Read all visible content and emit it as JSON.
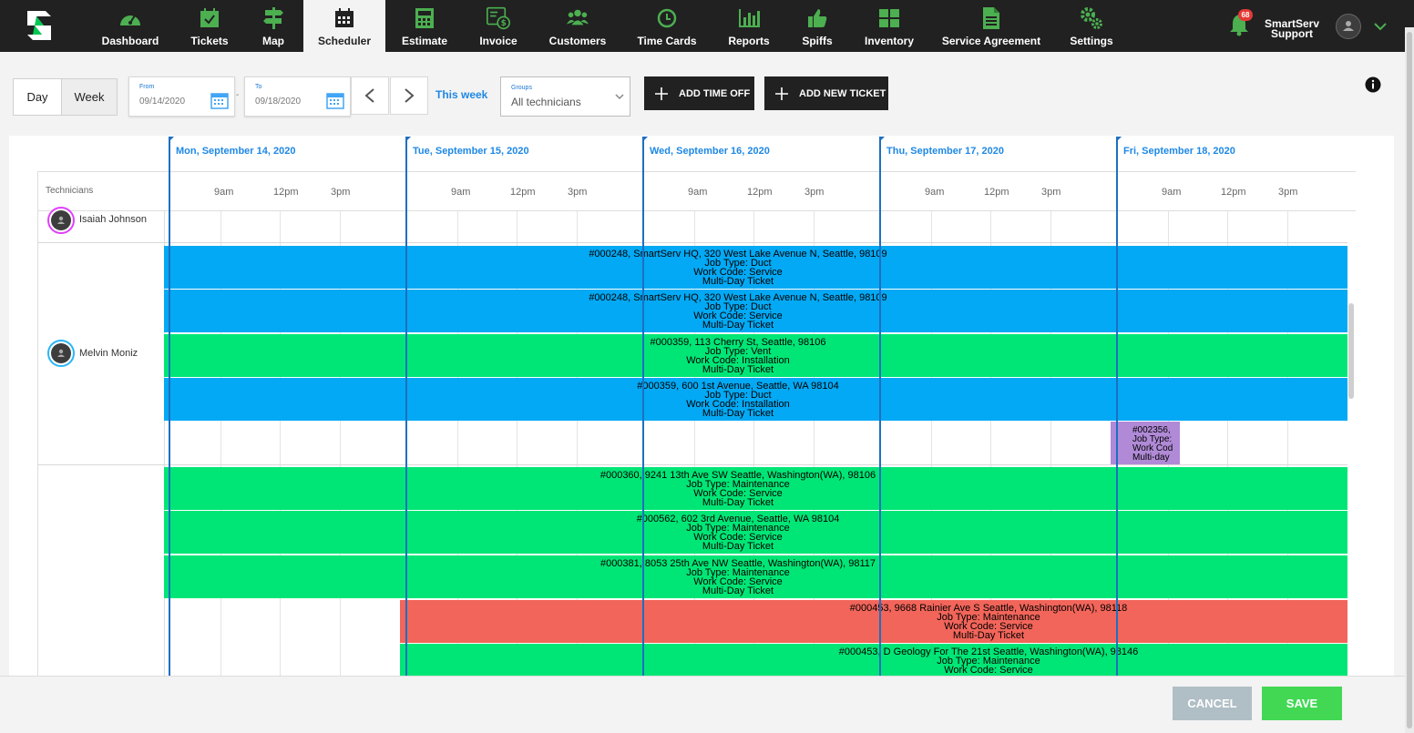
{
  "nav": {
    "items": [
      {
        "label": "Dashboard",
        "icon": "dashboard-icon"
      },
      {
        "label": "Tickets",
        "icon": "tickets-icon"
      },
      {
        "label": "Map",
        "icon": "map-icon"
      },
      {
        "label": "Scheduler",
        "icon": "scheduler-icon"
      },
      {
        "label": "Estimate",
        "icon": "estimate-icon"
      },
      {
        "label": "Invoice",
        "icon": "invoice-icon"
      },
      {
        "label": "Customers",
        "icon": "customers-icon"
      },
      {
        "label": "Time Cards",
        "icon": "time-cards-icon"
      },
      {
        "label": "Reports",
        "icon": "reports-icon"
      },
      {
        "label": "Spiffs",
        "icon": "spiffs-icon"
      },
      {
        "label": "Inventory",
        "icon": "inventory-icon"
      },
      {
        "label": "Service Agreement",
        "icon": "service-agreement-icon"
      },
      {
        "label": "Settings",
        "icon": "settings-icon"
      }
    ],
    "active": "Scheduler",
    "notification_count": "68",
    "user_line1": "SmartServ",
    "user_line2": "Support"
  },
  "toolbar": {
    "day_label": "Day",
    "week_label": "Week",
    "from_label": "From",
    "from_value": "09/14/2020",
    "to_label": "To",
    "to_value": "09/18/2020",
    "separator": "-",
    "this_week": "This week",
    "groups_label": "Groups",
    "groups_value": "All technicians",
    "add_time_off": "ADD TIME OFF",
    "add_new_ticket": "ADD NEW TICKET"
  },
  "scheduler": {
    "technicians_header": "Technicians",
    "days": [
      "Mon, September 14, 2020",
      "Tue, September 15, 2020",
      "Wed, September 16, 2020",
      "Thu, September 17, 2020",
      "Fri, September 18, 2020"
    ],
    "time_ticks": [
      "9am",
      "12pm",
      "3pm"
    ],
    "technicians": [
      {
        "name": "Isaiah Johnson"
      },
      {
        "name": "Melvin Moniz"
      }
    ],
    "events": [
      {
        "lines": [
          "#000248, SmartServ HQ, 320 West Lake Avenue N, Seattle, 98109",
          "Job Type: Duct",
          "Work Code: Service",
          "Multi-Day Ticket"
        ],
        "color": "blue"
      },
      {
        "lines": [
          "#000248, SmartServ HQ, 320 West Lake Avenue N, Seattle, 98109",
          "Job Type: Duct",
          "Work Code: Service",
          "Multi-Day Ticket"
        ],
        "color": "blue"
      },
      {
        "lines": [
          "#000359, 113 Cherry St, Seattle, 98106",
          "Job Type: Vent",
          "Work Code: Installation",
          "Multi-Day Ticket"
        ],
        "color": "green"
      },
      {
        "lines": [
          "#000359, 600 1st Avenue, Seattle, WA 98104",
          "Job Type: Duct",
          "Work Code: Installation",
          "Multi-Day Ticket"
        ],
        "color": "blue"
      },
      {
        "lines": [
          "#000360, 9241 13th Ave SW Seattle, Washington(WA), 98106",
          "Job Type: Maintenance",
          "Work Code: Service",
          "Multi-Day Ticket"
        ],
        "color": "green"
      },
      {
        "lines": [
          "#000562, 602 3rd Avenue, Seattle, WA 98104",
          "Job Type: Maintenance",
          "Work Code: Service",
          "Multi-Day Ticket"
        ],
        "color": "green"
      },
      {
        "lines": [
          "#000381, 8053 25th Ave NW Seattle, Washington(WA), 98117",
          "Job Type: Maintenance",
          "Work Code: Service",
          "Multi-Day Ticket"
        ],
        "color": "green"
      },
      {
        "lines": [
          "#000453, 9668 Rainier Ave S Seattle, Washington(WA), 98118",
          "Job Type: Maintenance",
          "Work Code: Service",
          "Multi-Day Ticket"
        ],
        "color": "red"
      },
      {
        "lines": [
          "#000453, D Geology For The 21st Seattle, Washington(WA), 98146",
          "Job Type: Maintenance",
          "Work Code: Service"
        ],
        "color": "green"
      }
    ],
    "small_event": {
      "lines": [
        "#002356,",
        "Job Type:",
        "Work Cod",
        "Multi-day"
      ]
    }
  },
  "footer": {
    "cancel_label": "CANCEL",
    "save_label": "SAVE"
  },
  "colors": {
    "blue": "#03a9f4",
    "green": "#00e676",
    "red": "#f2655a",
    "purple": "#b08ad6",
    "accent": "#1e88e5",
    "save": "#43d854"
  }
}
